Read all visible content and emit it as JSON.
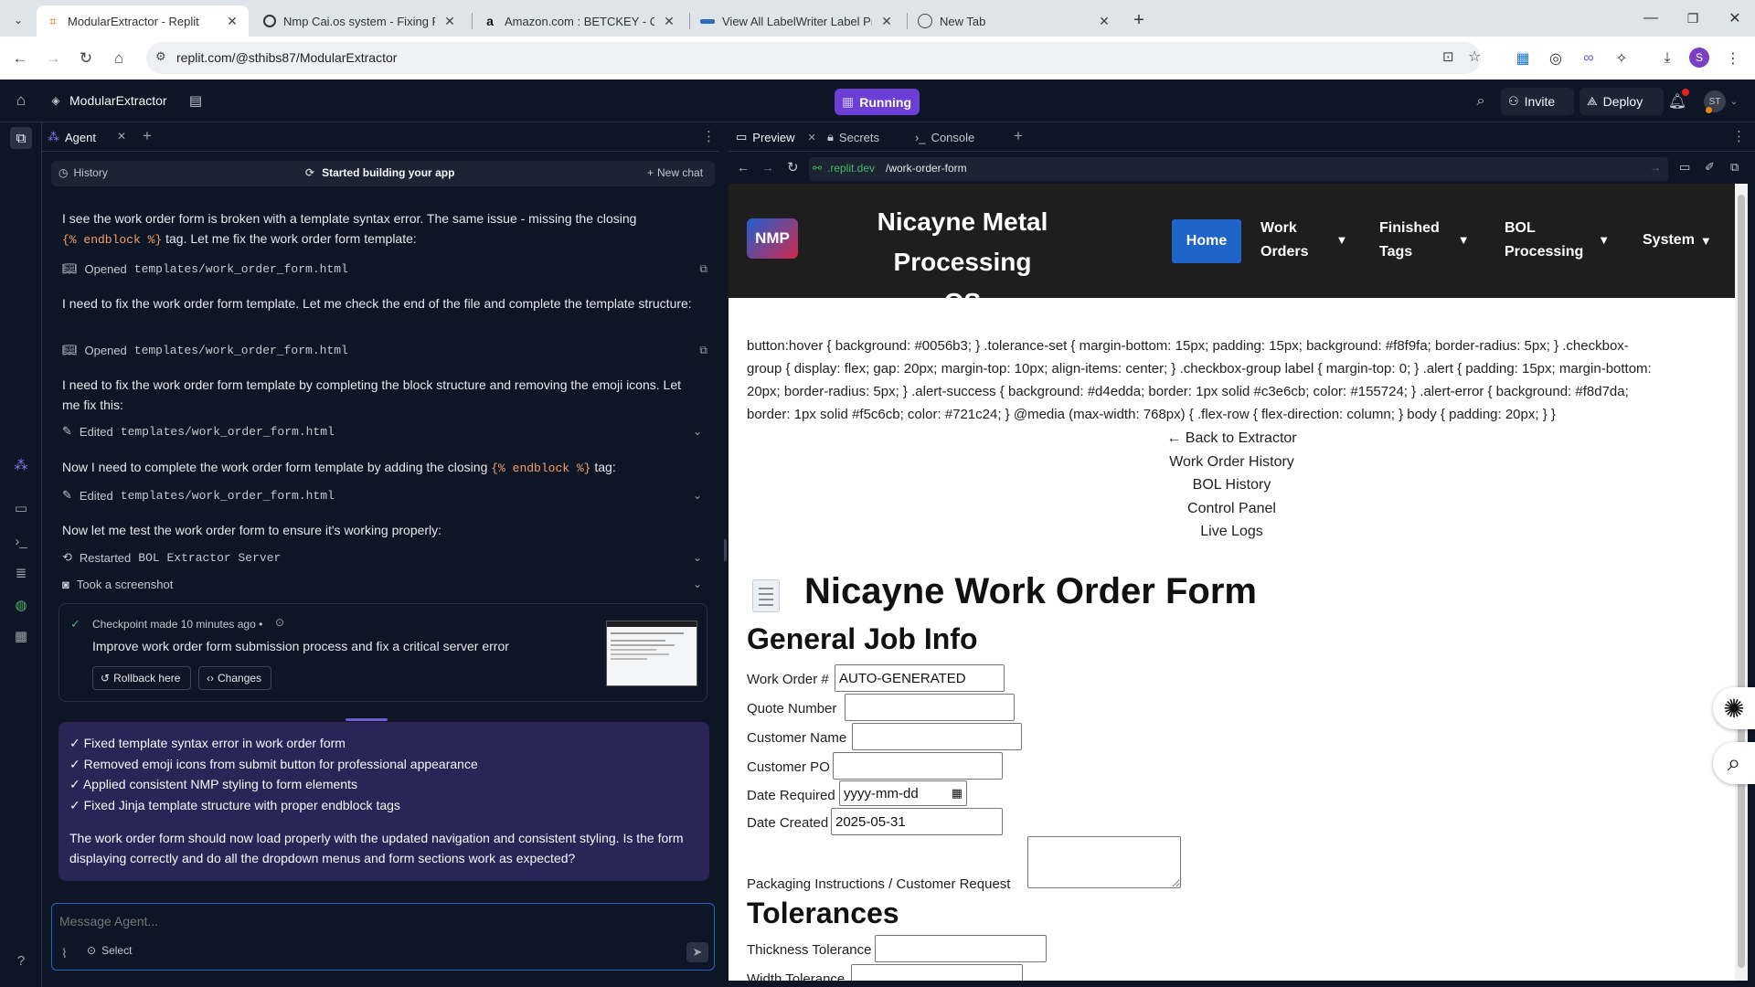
{
  "browser": {
    "tabs": [
      {
        "title": "ModularExtractor - Replit",
        "active": true
      },
      {
        "title": "Nmp Cai.os system - Fixing File",
        "active": false
      },
      {
        "title": "Amazon.com : BETCKEY - Comp",
        "active": false
      },
      {
        "title": "View All LabelWriter Label Print",
        "active": false
      },
      {
        "title": "New Tab",
        "active": false
      }
    ],
    "url": "replit.com/@sthibs87/ModularExtractor",
    "profile_initial": "S"
  },
  "replit": {
    "project_name": "ModularExtractor",
    "run_status": "Running",
    "invite_label": "Invite",
    "deploy_label": "Deploy",
    "avatar_initials": "ST"
  },
  "agent": {
    "tab_label": "Agent",
    "history_label": "History",
    "status_title": "Started building your app",
    "new_chat_label": "New chat",
    "messages": [
      {
        "pre": "I see the work order form is broken with a template syntax error. The same issue - missing the closing",
        "code": "{% endblock %}",
        "post": "tag. Let me fix the work order form template:"
      },
      {
        "text": "I need to fix the work order form template. Let me check the end of the file and complete the template structure:"
      },
      {
        "text": "I need to fix the work order form template by completing the block structure and removing the emoji icons. Let me fix this:"
      },
      {
        "pre": "Now I need to complete the work order form template by adding the closing",
        "code": "{% endblock %}",
        "post": "tag:"
      },
      {
        "text": "Now let me test the work order form to ensure it's working properly:"
      }
    ],
    "actions": [
      {
        "verb": "Opened",
        "target": "templates/work_order_form.html"
      },
      {
        "verb": "Opened",
        "target": "templates/work_order_form.html"
      },
      {
        "verb": "Edited",
        "target": "templates/work_order_form.html"
      },
      {
        "verb": "Edited",
        "target": "templates/work_order_form.html"
      },
      {
        "verb": "Restarted",
        "target": "BOL Extractor Server"
      },
      {
        "verb": "Took a screenshot",
        "target": ""
      }
    ],
    "checkpoint": {
      "meta": "Checkpoint made 10 minutes ago •",
      "description": "Improve work order form submission process and fix a critical server error",
      "rollback_label": "Rollback here",
      "changes_label": "Changes"
    },
    "summary": {
      "items": [
        "✓ Fixed template syntax error in work order form",
        "✓ Removed emoji icons from submit button for professional appearance",
        "✓ Applied consistent NMP styling to form elements",
        "✓ Fixed Jinja template structure with proper endblock tags"
      ],
      "question": "The work order form should now load properly with the updated navigation and consistent styling. Is the form displaying correctly and do all the dropdown menus and form sections work as expected?"
    },
    "input_placeholder": "Message Agent...",
    "select_label": "Select"
  },
  "workspace": {
    "tabs": [
      {
        "label": "Preview",
        "active": true
      },
      {
        "label": "Secrets",
        "active": false
      },
      {
        "label": "Console",
        "active": false
      }
    ],
    "preview_url_domain": ".replit.dev",
    "preview_url_path": "/work-order-form"
  },
  "app": {
    "logo": "NMP",
    "brand_line1": "Nicayne Metal Processing",
    "brand_line2": "OS",
    "nav": {
      "home": "Home",
      "work_orders_1": "Work",
      "work_orders_2": "Orders",
      "finished_tags_1": "Finished",
      "finished_tags_2": "Tags",
      "bol_1": "BOL",
      "bol_2": "Processing",
      "system": "System",
      "caret": "▼"
    },
    "css_dump": [
      "button:hover { background: #0056b3; } .tolerance-set { margin-bottom: 15px; padding: 15px; background: #f8f9fa; border-radius: 5px; } .checkbox-",
      "group { display: flex; gap: 20px; margin-top: 10px; align-items: center; } .checkbox-group label { margin-top: 0; } .alert { padding: 15px; margin-bottom:",
      "20px; border-radius: 5px; } .alert-success { background: #d4edda; border: 1px solid #c3e6cb; color: #155724; } .alert-error { background: #f8d7da;",
      "border: 1px solid #f5c6cb; color: #721c24; } @media (max-width: 768px) { .flex-row { flex-direction: column; } body { padding: 20px; } }"
    ],
    "links": [
      "← Back to Extractor",
      "Work Order History",
      "BOL History",
      "Control Panel",
      "Live Logs"
    ],
    "form_title": "Nicayne Work Order Form",
    "section_general": "General Job Info",
    "fields": {
      "work_order_label": "Work Order #",
      "work_order_value": "AUTO-GENERATED",
      "quote_label": "Quote Number",
      "customer_name_label": "Customer Name",
      "customer_po_label": "Customer PO",
      "date_required_label": "Date Required",
      "date_required_value": "yyyy-mm-dd",
      "date_created_label": "Date Created",
      "date_created_value": "2025-05-31",
      "packaging_label": "Packaging Instructions / Customer Request"
    },
    "section_tolerances": "Tolerances",
    "thickness_label": "Thickness Tolerance",
    "width_label": "Width Tolerance"
  },
  "colors": {
    "running": "#6b3fd6",
    "home_nav": "#1f64c8",
    "app_header": "#1e1e1e",
    "agent_bg": "#0e1525",
    "summary_bg": "#2a2457"
  }
}
